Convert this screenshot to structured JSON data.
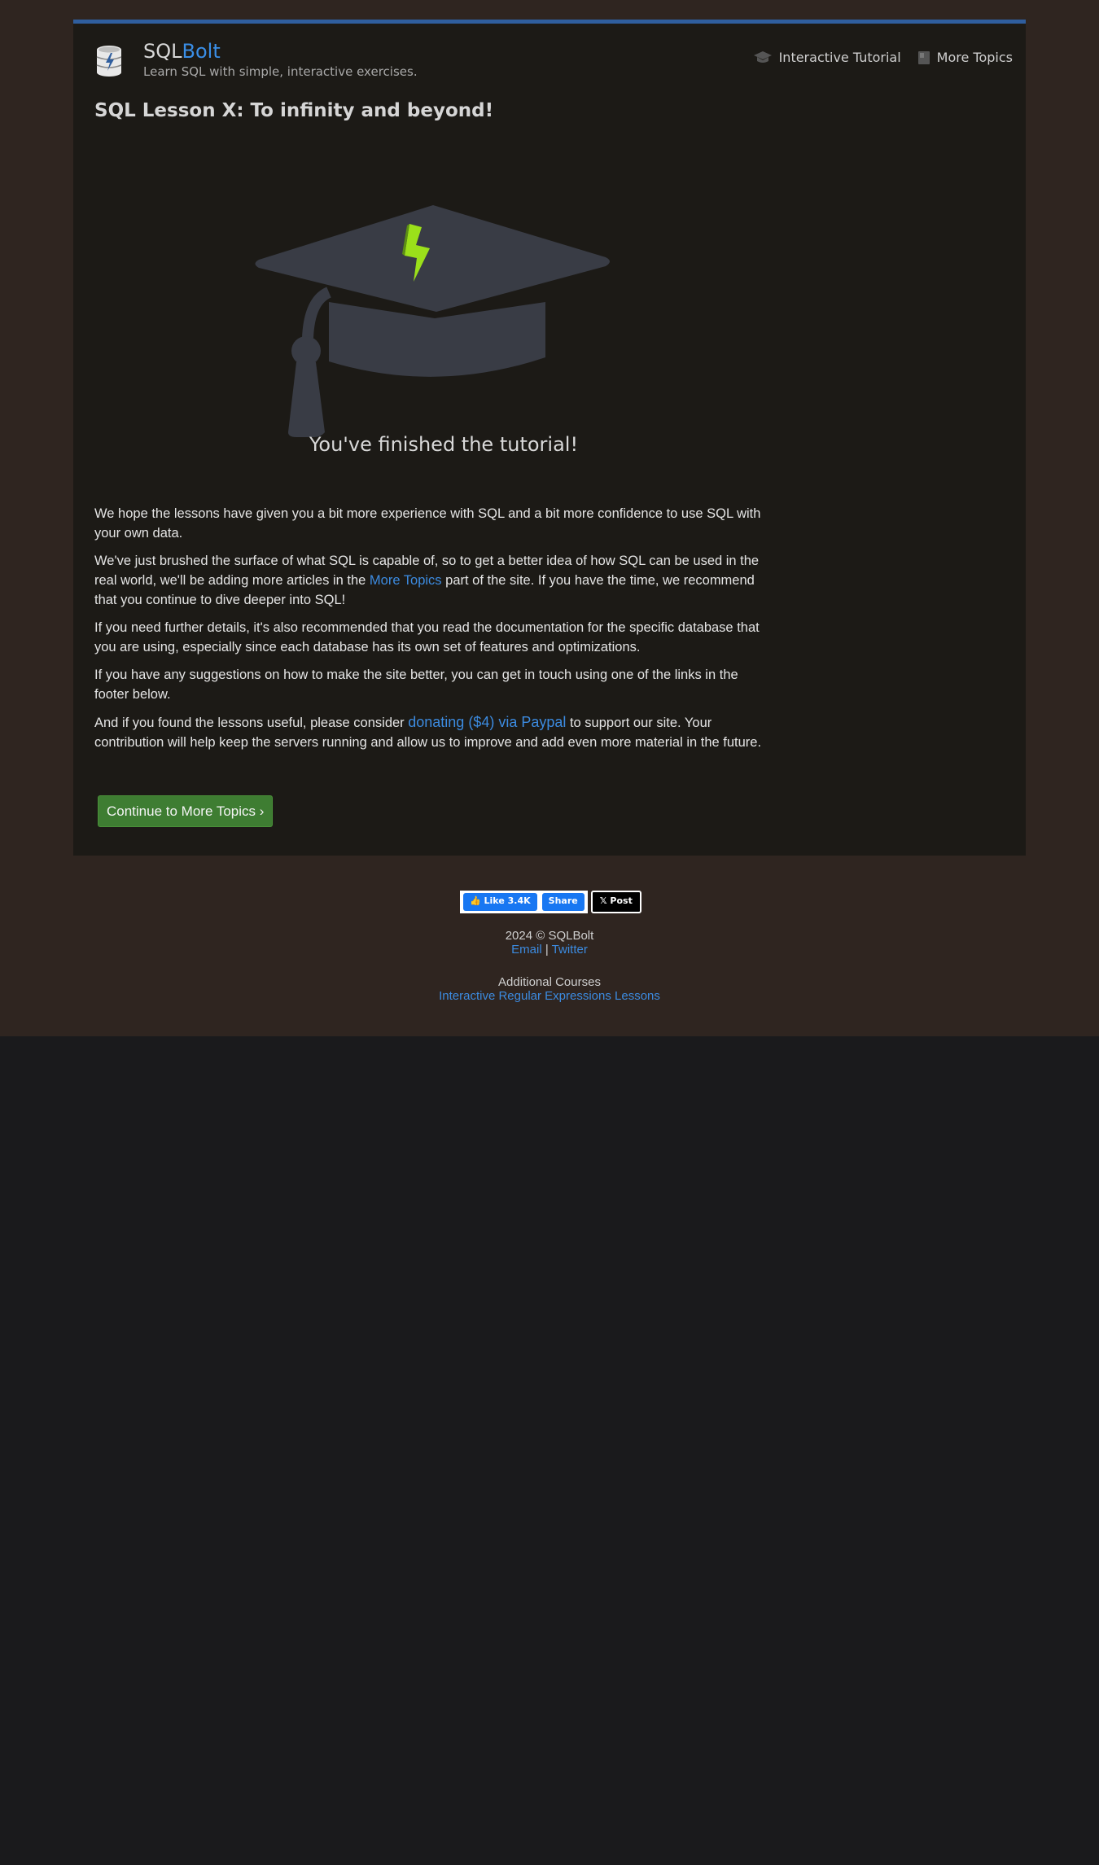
{
  "brand": {
    "sql": "SQL",
    "bolt": "Bolt",
    "tagline": "Learn SQL with simple, interactive exercises."
  },
  "nav": {
    "items": [
      {
        "label": "Interactive Tutorial",
        "icon": "graduation-cap-icon"
      },
      {
        "label": "More Topics",
        "icon": "book-icon"
      }
    ]
  },
  "page": {
    "title": "SQL Lesson X: To infinity and beyond!",
    "hero_caption": "You've finished the tutorial!"
  },
  "content": {
    "p1": "We hope the lessons have given you a bit more experience with SQL and a bit more confidence to use SQL with your own data.",
    "p2_before": "We've just brushed the surface of what SQL is capable of, so to get a better idea of how SQL can be used in the real world, we'll be adding more articles in the ",
    "p2_link": "More Topics",
    "p2_after": " part of the site. If you have the time, we recommend that you continue to dive deeper into SQL!",
    "p3": "If you need further details, it's also recommended that you read the documentation for the specific database that you are using, especially since each database has its own set of features and optimizations.",
    "p4": "If you have any suggestions on how to make the site better, you can get in touch using one of the links in the footer below.",
    "p5_before": "And if you found the lessons useful, please consider ",
    "p5_link": "donating ($4) via Paypal",
    "p5_after": " to support our site. Your contribution will help keep the servers running and allow us to improve and add even more material in the future.",
    "cta": "Continue to More Topics ›"
  },
  "social": {
    "like": "Like 3.4K",
    "share": "Share",
    "post": "Post"
  },
  "footer": {
    "copyright": "2024 © SQLBolt",
    "email": "Email",
    "separator": "|",
    "twitter": "Twitter",
    "additional": "Additional Courses",
    "regex": "Interactive Regular Expressions Lessons"
  },
  "colors": {
    "accent": "#3a8ee6",
    "cta": "#3e7d32",
    "bolt_green": "#9be01a"
  }
}
